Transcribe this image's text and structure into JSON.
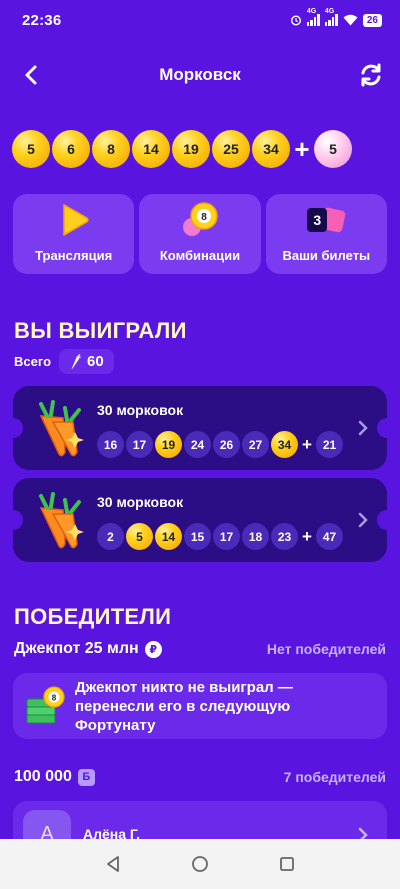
{
  "status": {
    "time": "22:36",
    "net1": "4G",
    "net2": "4G",
    "battery": "26"
  },
  "header": {
    "title": "Морковск",
    "back_icon": "arrow-left-icon",
    "refresh_icon": "refresh-icon"
  },
  "draw": {
    "numbers": [
      "5",
      "6",
      "8",
      "14",
      "19",
      "25",
      "34"
    ],
    "plus": "+",
    "bonus": "5"
  },
  "actions": [
    {
      "label": "Трансляция",
      "icon": "play-icon"
    },
    {
      "label": "Комбинации",
      "icon": "lotto-balls-icon"
    },
    {
      "label": "Ваши билеты",
      "icon": "tickets-icon",
      "badge": "3"
    }
  ],
  "won": {
    "title": "ВЫ ВЫИГРАЛИ",
    "total_label": "Всего",
    "total_value": "60",
    "tickets": [
      {
        "prize": "30 морковок",
        "numbers": [
          "16",
          "17",
          "19",
          "24",
          "26",
          "27",
          "34"
        ],
        "hits": [
          false,
          false,
          true,
          false,
          false,
          false,
          true
        ],
        "plus": "+",
        "bonus": "21"
      },
      {
        "prize": "30 морковок",
        "numbers": [
          "2",
          "5",
          "14",
          "15",
          "17",
          "18",
          "23"
        ],
        "hits": [
          false,
          true,
          true,
          false,
          false,
          false,
          false
        ],
        "plus": "+",
        "bonus": "47"
      }
    ]
  },
  "winners": {
    "title": "ПОБЕДИТЕЛИ",
    "jackpot_label": "Джекпот 25 млн",
    "rub_symbol": "₽",
    "jackpot_status": "Нет победителей",
    "note": "Джекпот никто не выиграл — перенесли его в следующую Фортунату",
    "prize_amount": "100 000",
    "currency_symbol": "Б",
    "prize_winners": "7 победителей",
    "first_winner": {
      "initial": "А",
      "name": "Алёна Г."
    }
  },
  "colors": {
    "background": "#5a14e0",
    "card": "#7b3cf0",
    "ticket": "#2b0e86",
    "ball_yellow": "#ffd21f",
    "ball_pink": "#f7b3e4",
    "title_cream": "#fff7c8"
  }
}
